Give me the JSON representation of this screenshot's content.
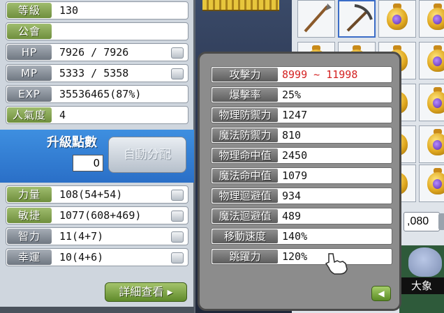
{
  "stats": {
    "level": {
      "label": "等級",
      "value": "130"
    },
    "guild": {
      "label": "公會",
      "value": ""
    },
    "hp": {
      "label": "HP",
      "value": "7926 / 7926"
    },
    "mp": {
      "label": "MP",
      "value": "5333 / 5358"
    },
    "exp": {
      "label": "EXP",
      "value": "35536465(87%)"
    },
    "fame": {
      "label": "人氣度",
      "value": "4"
    }
  },
  "ap": {
    "title": "升級點數",
    "value": "0",
    "auto_assign_label": "自動分配"
  },
  "attributes": [
    {
      "label": "力量",
      "value": "108(54+54)"
    },
    {
      "label": "敏捷",
      "value": "1077(608+469)"
    },
    {
      "label": "智力",
      "value": "11(4+7)"
    },
    {
      "label": "幸運",
      "value": "10(4+6)"
    }
  ],
  "detail_button_label": "詳細查看",
  "detail_stats": [
    {
      "label": "攻擊力",
      "value": "8999 ~ 11998",
      "color": "#d42222"
    },
    {
      "label": "爆擊率",
      "value": "25%"
    },
    {
      "label": "物理防禦力",
      "value": "1247"
    },
    {
      "label": "魔法防禦力",
      "value": "810"
    },
    {
      "label": "物理命中值",
      "value": "2450"
    },
    {
      "label": "魔法命中值",
      "value": "1079"
    },
    {
      "label": "物理迴避值",
      "value": "934"
    },
    {
      "label": "魔法迴避值",
      "value": "489"
    },
    {
      "label": "移動速度",
      "value": "140%"
    },
    {
      "label": "跳躍力",
      "value": "120%"
    }
  ],
  "inventory": {
    "meso_fragment": ",080",
    "pet_name": "大象"
  },
  "colors": {
    "accent_green": "#6f8f3d",
    "panel_blue": "#2a6fc7",
    "attack_red": "#d42222"
  }
}
